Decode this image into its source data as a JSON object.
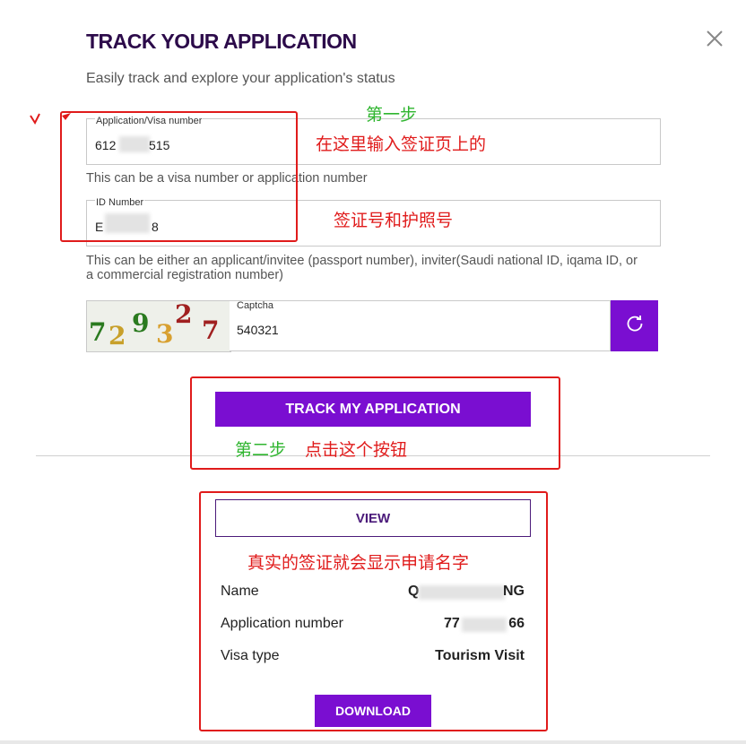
{
  "header": {
    "title": "TRACK YOUR APPLICATION",
    "subtitle": "Easily track and explore your application's status",
    "close_icon": "close-icon"
  },
  "form": {
    "application_field": {
      "label": "Application/Visa number",
      "value_prefix": "612",
      "value_suffix": "515"
    },
    "application_hint": "This can be a visa number or application number",
    "id_field": {
      "label": "ID Number",
      "value_prefix": "E",
      "value_suffix": "8"
    },
    "id_hint_line1": "This can be either an applicant/invitee (passport number), inviter(Saudi national ID, iqama ID, or",
    "id_hint_line2": "a commercial registration number)",
    "captcha": {
      "digits": [
        "7",
        "2",
        "9",
        "3",
        "2",
        "7"
      ],
      "label": "Captcha",
      "value": "540321",
      "refresh_icon": "refresh-icon"
    },
    "track_button": "TRACK MY APPLICATION"
  },
  "result": {
    "view_button": "VIEW",
    "rows": [
      {
        "label": "Name",
        "value": "Q",
        "value_tail": "NG"
      },
      {
        "label": "Application number",
        "value": "77",
        "value_tail": "66"
      },
      {
        "label": "Visa type",
        "value": "Tourism Visit",
        "value_tail": ""
      }
    ],
    "download_button": "DOWNLOAD"
  },
  "annotations": {
    "step1": "第一步",
    "step1_note": "在这里输入签证页上的",
    "step1_note2": "签证号和护照号",
    "step2": "第二步",
    "step2_note": "点击这个按钮",
    "result_note": "真实的签证就会显示申请名字"
  },
  "colors": {
    "accent": "#7a0ed1",
    "title": "#2c0b4a",
    "annotation_red": "#e01b1b",
    "annotation_green": "#2fb52f"
  }
}
